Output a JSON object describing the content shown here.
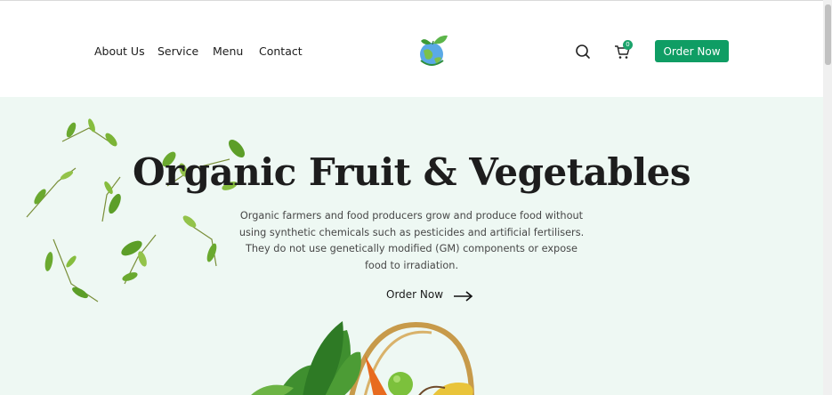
{
  "nav": {
    "items": [
      {
        "label": "About Us"
      },
      {
        "label": "Service"
      },
      {
        "label": "Menu"
      },
      {
        "label": "Contact"
      }
    ]
  },
  "header": {
    "logo_icon": "globe-leaf-logo",
    "search_icon": "search-icon",
    "cart_icon": "cart-icon",
    "cart_count": "0",
    "order_button_label": "Order Now"
  },
  "hero": {
    "title": "Organic Fruit & Vegetables",
    "description": "Organic farmers and food producers grow and produce food without using synthetic chemicals such as pesticides and artificial fertilisers. They do not use genetically modified (GM) components or expose food to irradiation.",
    "cta_label": "Order Now",
    "cta_icon": "arrow-right-icon"
  },
  "colors": {
    "accent": "#0f9d64",
    "hero_background": "#eef8f3",
    "leaf_green": "#6aa92f"
  }
}
